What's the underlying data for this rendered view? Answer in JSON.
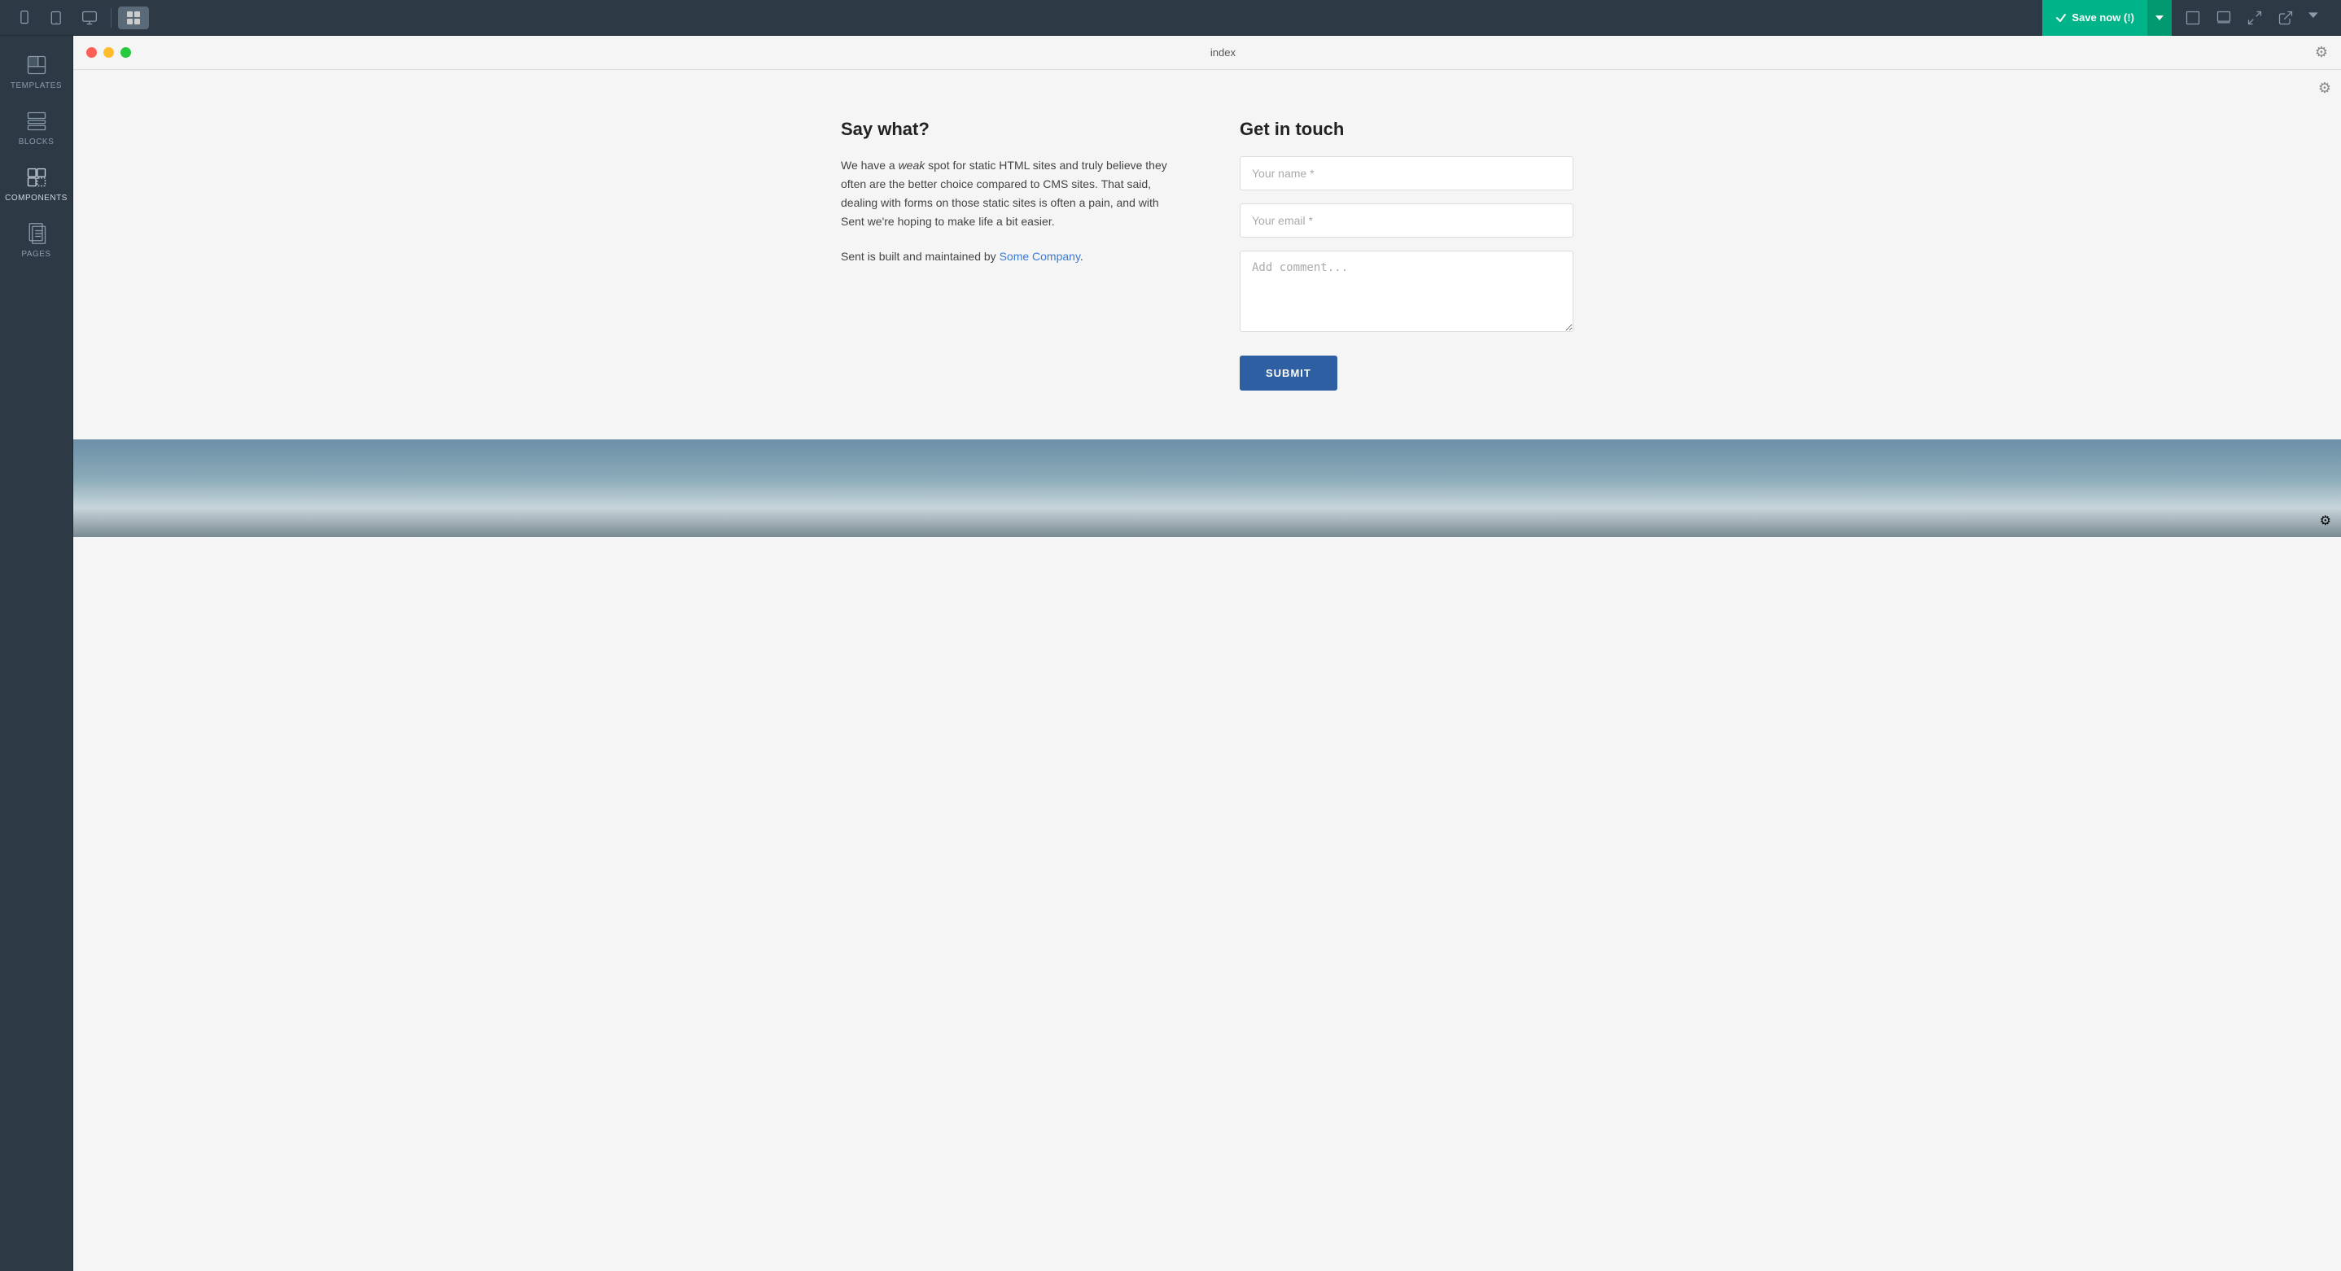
{
  "toolbar": {
    "save_label": "Save now (!)",
    "devices": [
      {
        "name": "mobile",
        "icon": "mobile"
      },
      {
        "name": "tablet",
        "icon": "tablet"
      },
      {
        "name": "desktop",
        "icon": "desktop"
      }
    ],
    "view_icons": [
      "frame",
      "frame-alt",
      "preview",
      "external"
    ]
  },
  "browser": {
    "title": "index",
    "traffic_lights": [
      "red",
      "yellow",
      "green"
    ]
  },
  "sidebar": {
    "items": [
      {
        "id": "templates",
        "label": "TEMPLATES"
      },
      {
        "id": "blocks",
        "label": "BLOCKS"
      },
      {
        "id": "components",
        "label": "COMPONENTS",
        "active": true
      },
      {
        "id": "pages",
        "label": "PAGES"
      }
    ]
  },
  "content": {
    "left": {
      "title": "Say what?",
      "body_parts": [
        "We have a ",
        "weak",
        " spot for static HTML sites and truly believe they often are the better choice compared to CMS sites. That said, dealing with forms on those static sites is often a pain, and with Sent we're hoping to make life a bit easier."
      ],
      "footer_text": "Sent is built and maintained by ",
      "footer_link": "Some Company",
      "footer_end": "."
    },
    "right": {
      "title": "Get in touch",
      "form": {
        "name_placeholder": "Your name *",
        "email_placeholder": "Your email *",
        "comment_placeholder": "Add comment...",
        "submit_label": "SUBMIT"
      }
    }
  }
}
